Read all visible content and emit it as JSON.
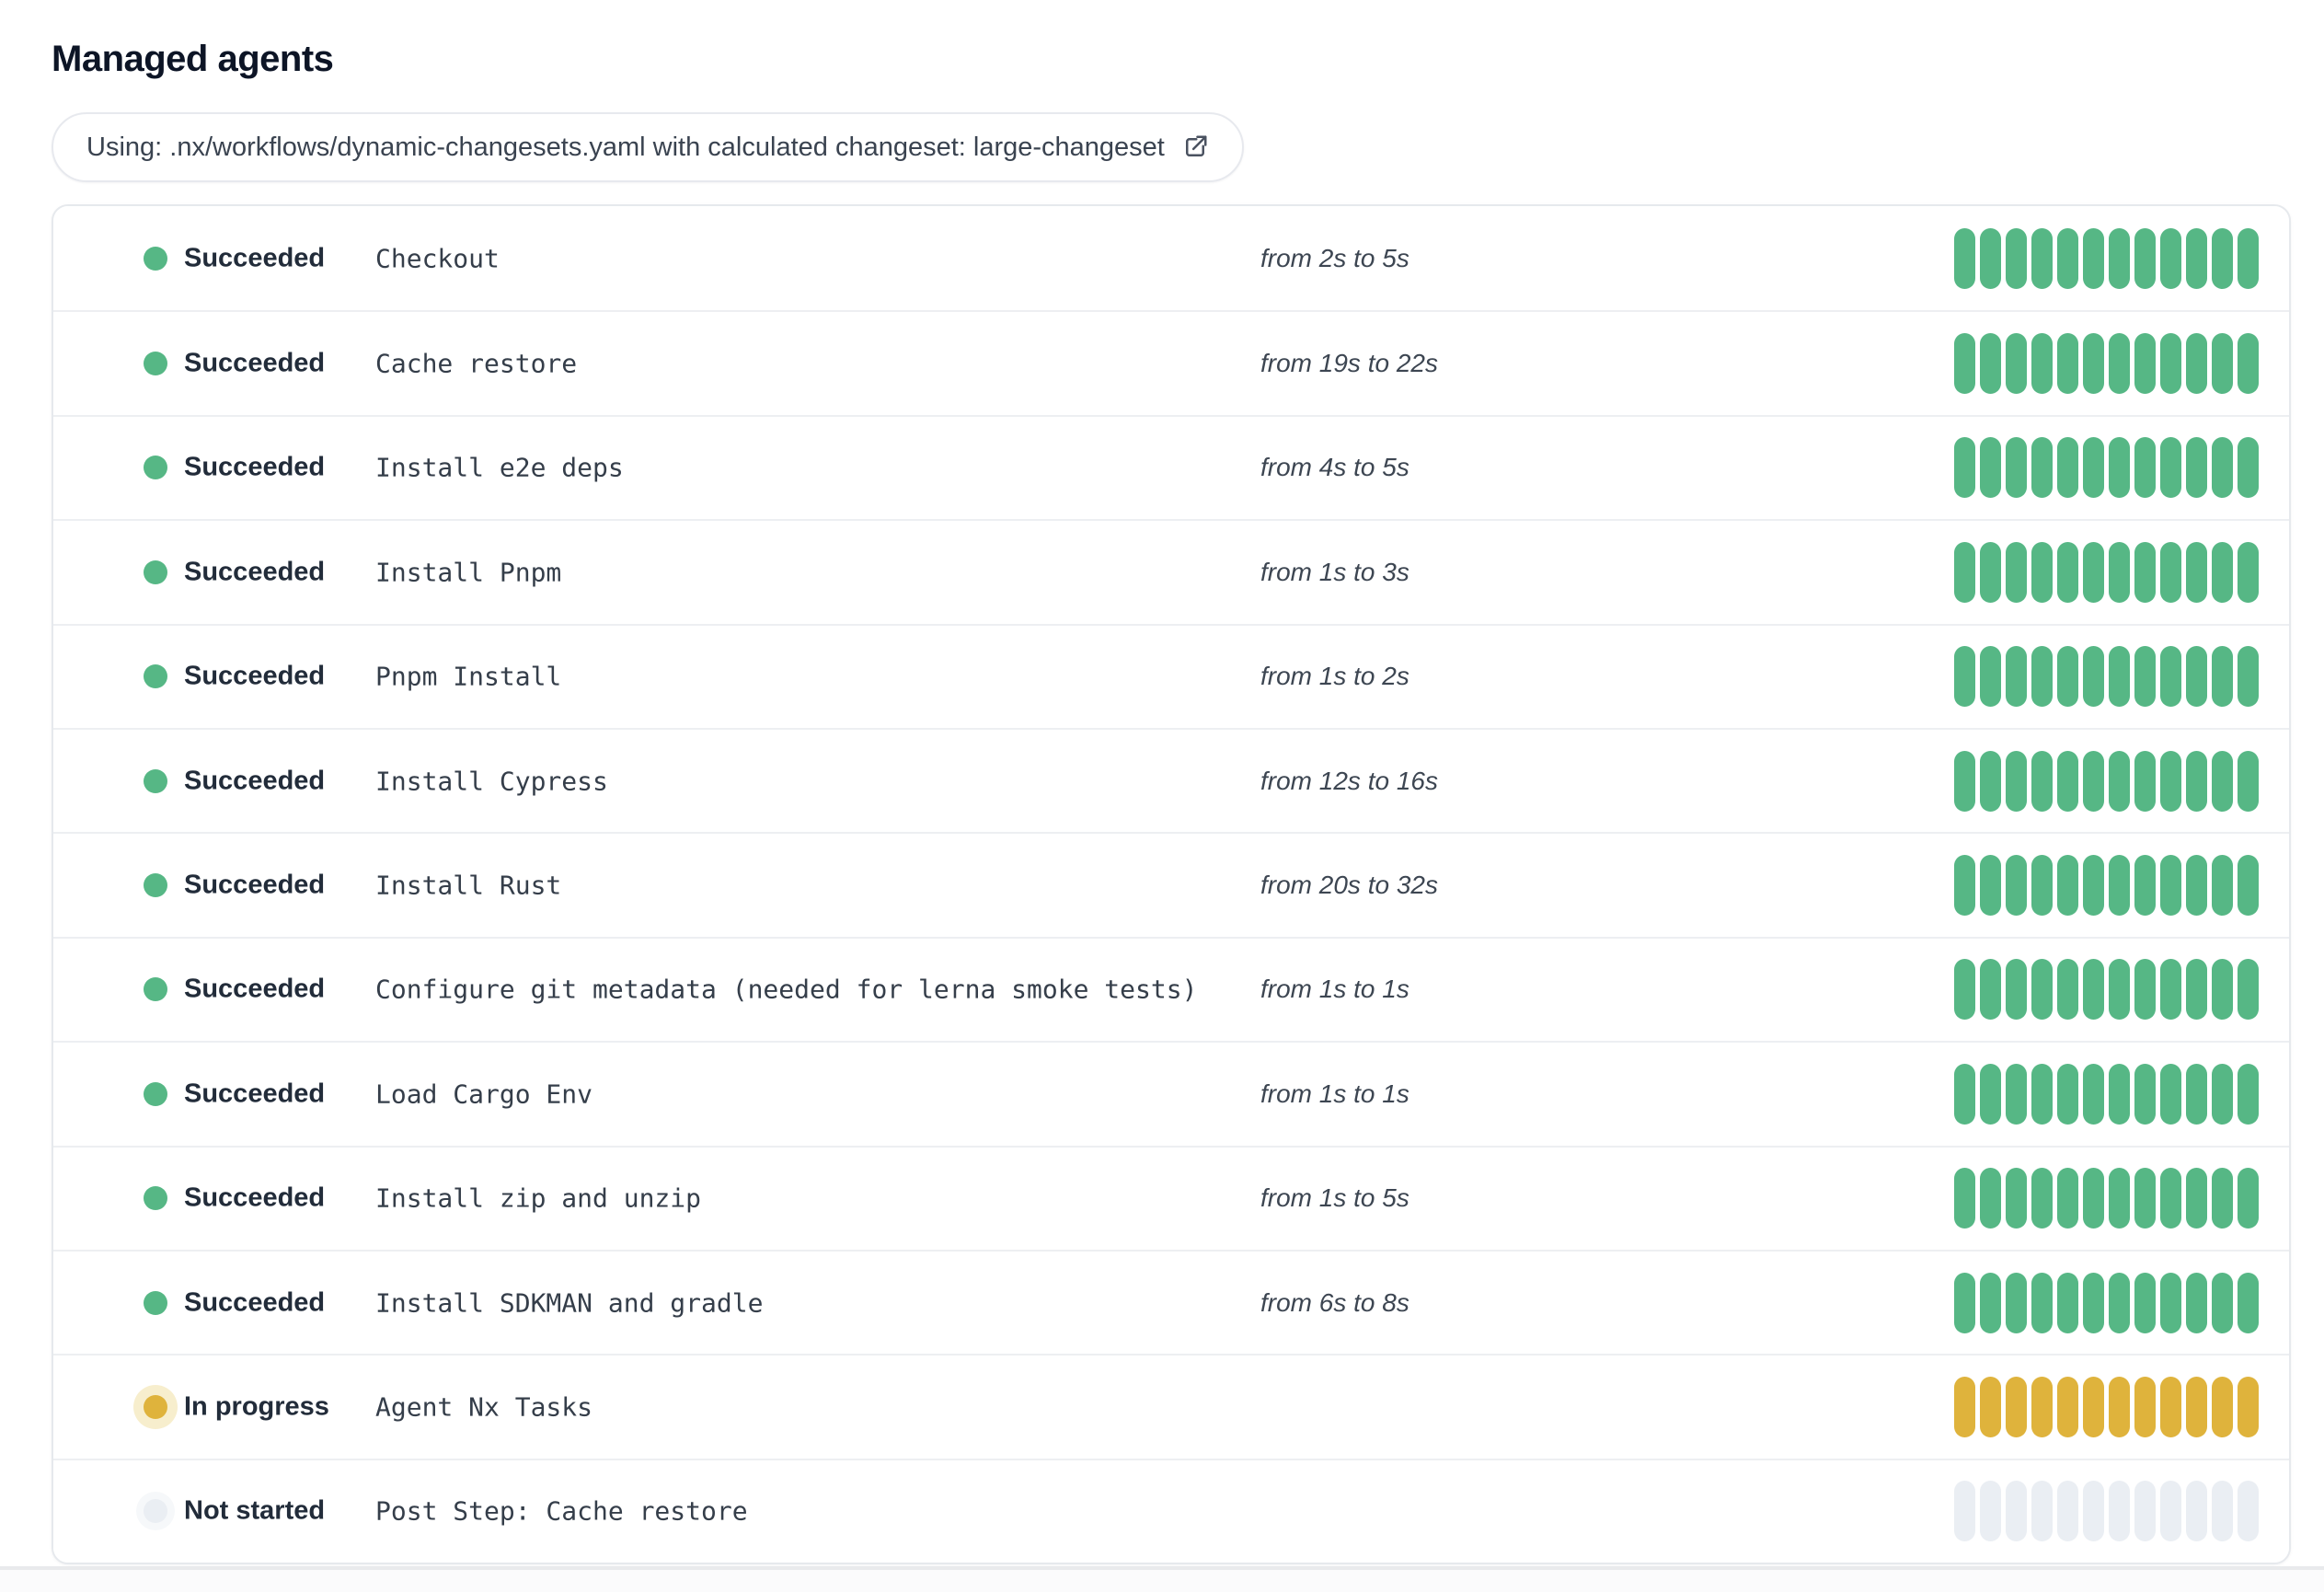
{
  "page": {
    "title": "Managed agents"
  },
  "config_chip": {
    "label": "Using: .nx/workflows/dynamic-changesets.yaml with calculated changeset: large-changeset",
    "icon": "external-link-icon"
  },
  "bar": {
    "segments": 12
  },
  "colors": {
    "succeeded": "#56b785",
    "in_progress": "#dfb33c",
    "not_started": "#eaeef3"
  },
  "rows": [
    {
      "state": "succeeded",
      "status": "Succeeded",
      "step": "Checkout",
      "duration": "from 2s to 5s"
    },
    {
      "state": "succeeded",
      "status": "Succeeded",
      "step": "Cache restore",
      "duration": "from 19s to 22s"
    },
    {
      "state": "succeeded",
      "status": "Succeeded",
      "step": "Install e2e deps",
      "duration": "from 4s to 5s"
    },
    {
      "state": "succeeded",
      "status": "Succeeded",
      "step": "Install Pnpm",
      "duration": "from 1s to 3s"
    },
    {
      "state": "succeeded",
      "status": "Succeeded",
      "step": "Pnpm Install",
      "duration": "from 1s to 2s"
    },
    {
      "state": "succeeded",
      "status": "Succeeded",
      "step": "Install Cypress",
      "duration": "from 12s to 16s"
    },
    {
      "state": "succeeded",
      "status": "Succeeded",
      "step": "Install Rust",
      "duration": "from 20s to 32s"
    },
    {
      "state": "succeeded",
      "status": "Succeeded",
      "step": "Configure git metadata (needed for lerna smoke tests)",
      "duration": "from 1s to 1s"
    },
    {
      "state": "succeeded",
      "status": "Succeeded",
      "step": "Load Cargo Env",
      "duration": "from 1s to 1s"
    },
    {
      "state": "succeeded",
      "status": "Succeeded",
      "step": "Install zip and unzip",
      "duration": "from 1s to 5s"
    },
    {
      "state": "succeeded",
      "status": "Succeeded",
      "step": "Install SDKMAN and gradle",
      "duration": "from 6s to 8s"
    },
    {
      "state": "in-progress",
      "status": "In progress",
      "step": "Agent Nx Tasks",
      "duration": ""
    },
    {
      "state": "not-started",
      "status": "Not started",
      "step": "Post Step: Cache restore",
      "duration": ""
    }
  ]
}
